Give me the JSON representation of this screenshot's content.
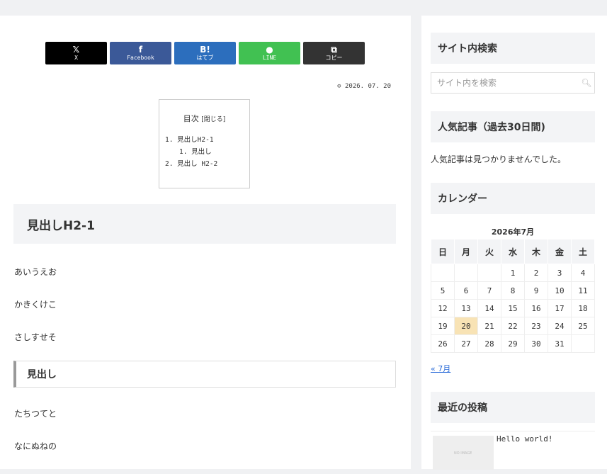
{
  "share": {
    "buttons": [
      {
        "icon": "𝕏",
        "label": "X",
        "color": "#000000"
      },
      {
        "icon": "f",
        "label": "Facebook",
        "color": "#3b5998"
      },
      {
        "icon": "B!",
        "label": "はてブ",
        "color": "#2c6ebd"
      },
      {
        "icon": "●",
        "label": "LINE",
        "color": "#41c152"
      },
      {
        "icon": "⧉",
        "label": "コピー",
        "color": "#333333"
      }
    ]
  },
  "post": {
    "date": "⊙ 2026. 07. 20",
    "toc": {
      "title": "目次",
      "toggle": "[閉じる]",
      "items": [
        "1. 見出しH2-1",
        "1. 見出し",
        "2. 見出し H2-2"
      ]
    },
    "h2": "見出しH2-1",
    "paragraphs": [
      "あいうえお",
      "かきくけこ",
      "さしすせそ",
      "たちつてと",
      "なにぬねの"
    ],
    "h3": "見出し"
  },
  "sidebar": {
    "search_title": "サイト内検索",
    "search_placeholder": "サイト内を検索",
    "popular_title": "人気記事（過去30日間)",
    "popular_empty": "人気記事は見つかりませんでした。",
    "calendar_title": "カレンダー",
    "calendar": {
      "caption": "2026年7月",
      "weekdays": [
        "日",
        "月",
        "火",
        "水",
        "木",
        "金",
        "土"
      ],
      "weeks": [
        [
          "",
          "",
          "",
          "1",
          "2",
          "3",
          "4"
        ],
        [
          "5",
          "6",
          "7",
          "8",
          "9",
          "10",
          "11"
        ],
        [
          "12",
          "13",
          "14",
          "15",
          "16",
          "17",
          "18"
        ],
        [
          "19",
          "20",
          "21",
          "22",
          "23",
          "24",
          "25"
        ],
        [
          "26",
          "27",
          "28",
          "29",
          "30",
          "31",
          ""
        ]
      ],
      "today": "20",
      "prev_link": "« 7月"
    },
    "recent_title": "最近の投稿",
    "recent_posts": [
      {
        "title": "Hello world!",
        "thumb_text": "NO IMAGE"
      }
    ]
  }
}
